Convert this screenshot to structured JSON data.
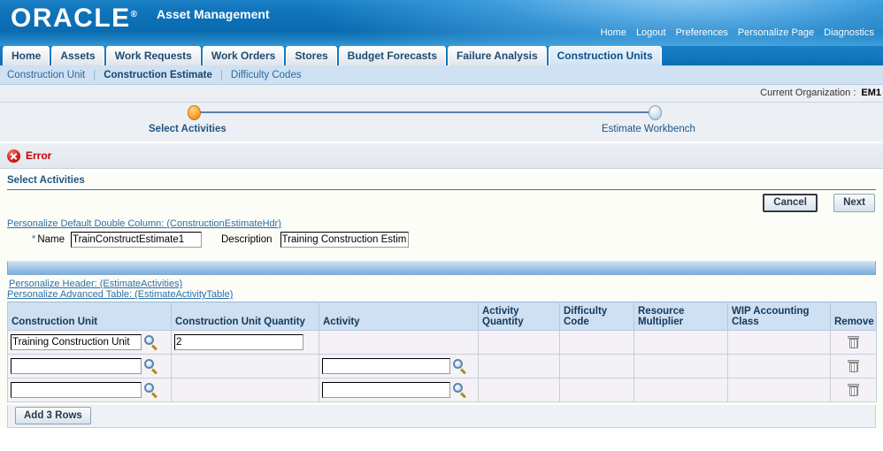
{
  "brand": {
    "logo": "ORACLE",
    "logo_reg": "®",
    "app_title": "Asset Management"
  },
  "global_links": [
    {
      "label": "Home"
    },
    {
      "label": "Logout"
    },
    {
      "label": "Preferences"
    },
    {
      "label": "Personalize Page"
    },
    {
      "label": "Diagnostics"
    }
  ],
  "tabs": [
    {
      "label": "Home",
      "selected": false
    },
    {
      "label": "Assets",
      "selected": false
    },
    {
      "label": "Work Requests",
      "selected": false
    },
    {
      "label": "Work Orders",
      "selected": false
    },
    {
      "label": "Stores",
      "selected": false
    },
    {
      "label": "Budget Forecasts",
      "selected": false
    },
    {
      "label": "Failure Analysis",
      "selected": false
    },
    {
      "label": "Construction Units",
      "selected": true
    }
  ],
  "subnav": [
    {
      "label": "Construction Unit",
      "current": false
    },
    {
      "label": "Construction Estimate",
      "current": true
    },
    {
      "label": "Difficulty Codes",
      "current": false
    }
  ],
  "org": {
    "label": "Current Organization :",
    "value": "EM1"
  },
  "train": {
    "step1_label": "Select Activities",
    "step2_label": "Estimate Workbench"
  },
  "error": {
    "icon": "error-icon",
    "label": "Error"
  },
  "section": {
    "title": "Select Activities"
  },
  "buttons": {
    "cancel": "Cancel",
    "next": "Next",
    "add_rows": "Add 3 Rows"
  },
  "personalize": {
    "header_double_column": "Personalize Default Double Column: (ConstructionEstimateHdr)",
    "header_estimate_activities": "Personalize Header: (EstimateActivities)",
    "advanced_table": "Personalize Advanced Table: (EstimateActivityTable)"
  },
  "form": {
    "name_label": "Name",
    "name_required_mark": "*",
    "name_value": "TrainConstructEstimate1",
    "description_label": "Description",
    "description_value": "Training Construction Estimate"
  },
  "table": {
    "columns": [
      "Construction Unit",
      "Construction Unit Quantity",
      "Activity",
      "Activity Quantity",
      "Difficulty Code",
      "Resource Multiplier",
      "WIP Accounting Class",
      "Remove"
    ],
    "rows": [
      {
        "construction_unit": "Training Construction Unit",
        "construction_unit_quantity": "2",
        "activity": "",
        "activity_has_field": false,
        "quantity_has_field": true,
        "activity_quantity": "",
        "difficulty_code": "",
        "resource_multiplier": "",
        "wip_accounting_class": ""
      },
      {
        "construction_unit": "",
        "construction_unit_quantity": "",
        "activity": "",
        "activity_has_field": true,
        "quantity_has_field": false,
        "activity_quantity": "",
        "difficulty_code": "",
        "resource_multiplier": "",
        "wip_accounting_class": ""
      },
      {
        "construction_unit": "",
        "construction_unit_quantity": "",
        "activity": "",
        "activity_has_field": true,
        "quantity_has_field": false,
        "activity_quantity": "",
        "difficulty_code": "",
        "resource_multiplier": "",
        "wip_accounting_class": ""
      }
    ]
  },
  "colors": {
    "brand_blue": "#0d6fb5",
    "tab_selected": "#cfe3f5",
    "subnav_bg": "#cfe1f2",
    "error_red": "#cc0000",
    "link_blue": "#2b6fa8",
    "header_text": "#1e5585",
    "train_active": "#fcae3a",
    "train_inactive": "#d6e6f4",
    "table_header": "#cfe0f2"
  }
}
